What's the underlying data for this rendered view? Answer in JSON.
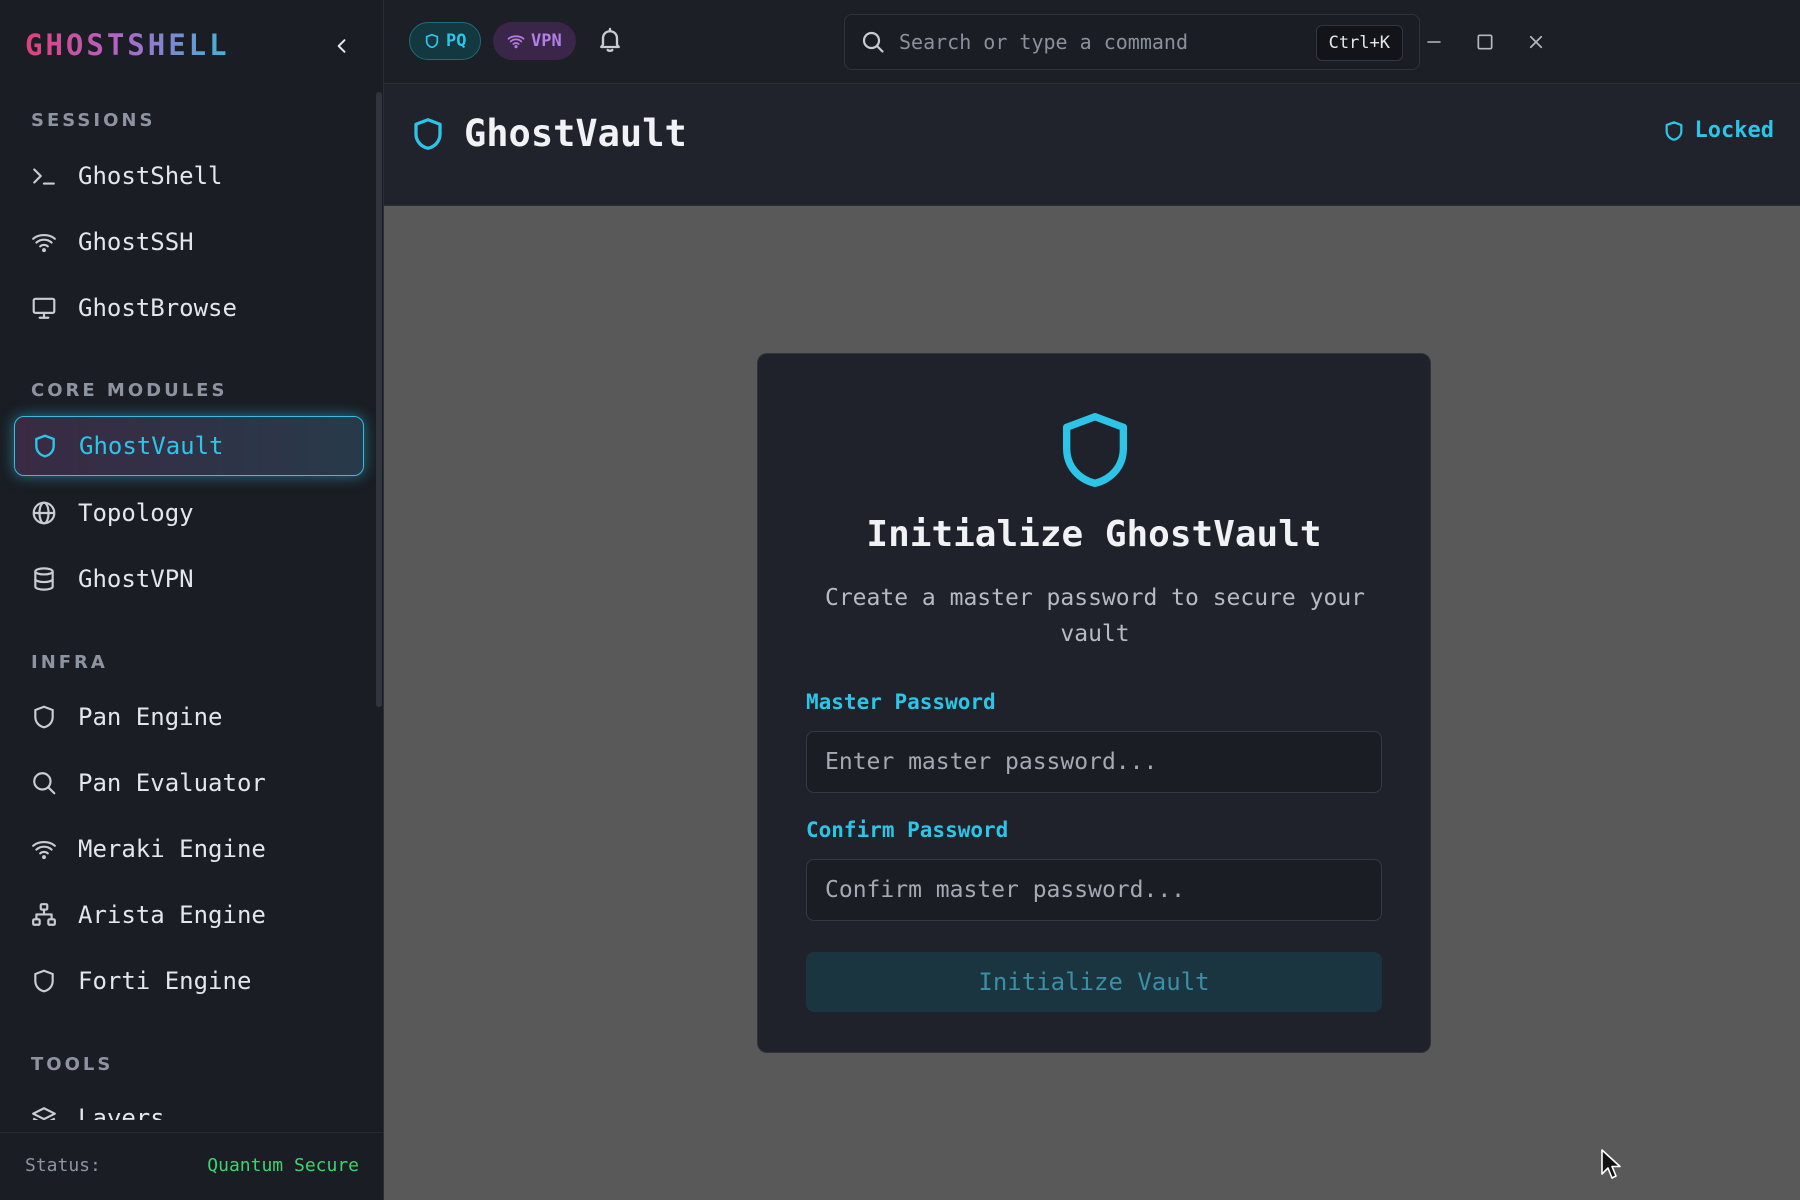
{
  "sidebar": {
    "brand": "GHOSTSHELL",
    "sections": {
      "sessions": "SESSIONS",
      "core": "CORE MODULES",
      "infra": "INFRA",
      "tools": "TOOLS"
    },
    "items": {
      "ghostshell": "GhostShell",
      "ghostssh": "GhostSSH",
      "ghostbrowse": "GhostBrowse",
      "ghostvault": "GhostVault",
      "topology": "Topology",
      "ghostvpn": "GhostVPN",
      "pan_engine": "Pan Engine",
      "pan_evaluator": "Pan Evaluator",
      "meraki_engine": "Meraki Engine",
      "arista_engine": "Arista Engine",
      "forti_engine": "Forti Engine",
      "layers": "Layers"
    },
    "status_label": "Status:",
    "status_value": "Quantum Secure"
  },
  "topbar": {
    "badge_pq": "PQ",
    "badge_vpn": "VPN",
    "search_placeholder": "Search or type a command",
    "shortcut": "Ctrl+K"
  },
  "header": {
    "title": "GhostVault",
    "lock_status": "Locked"
  },
  "card": {
    "title": "Initialize GhostVault",
    "subtitle": "Create a master password to secure your vault",
    "master_label": "Master Password",
    "master_placeholder": "Enter master password...",
    "confirm_label": "Confirm Password",
    "confirm_placeholder": "Confirm master password...",
    "button": "Initialize Vault"
  },
  "colors": {
    "accent": "#2cc5e8",
    "success": "#3ed36f",
    "vpn": "#b37ee6",
    "brand_pink": "#e0407a"
  }
}
